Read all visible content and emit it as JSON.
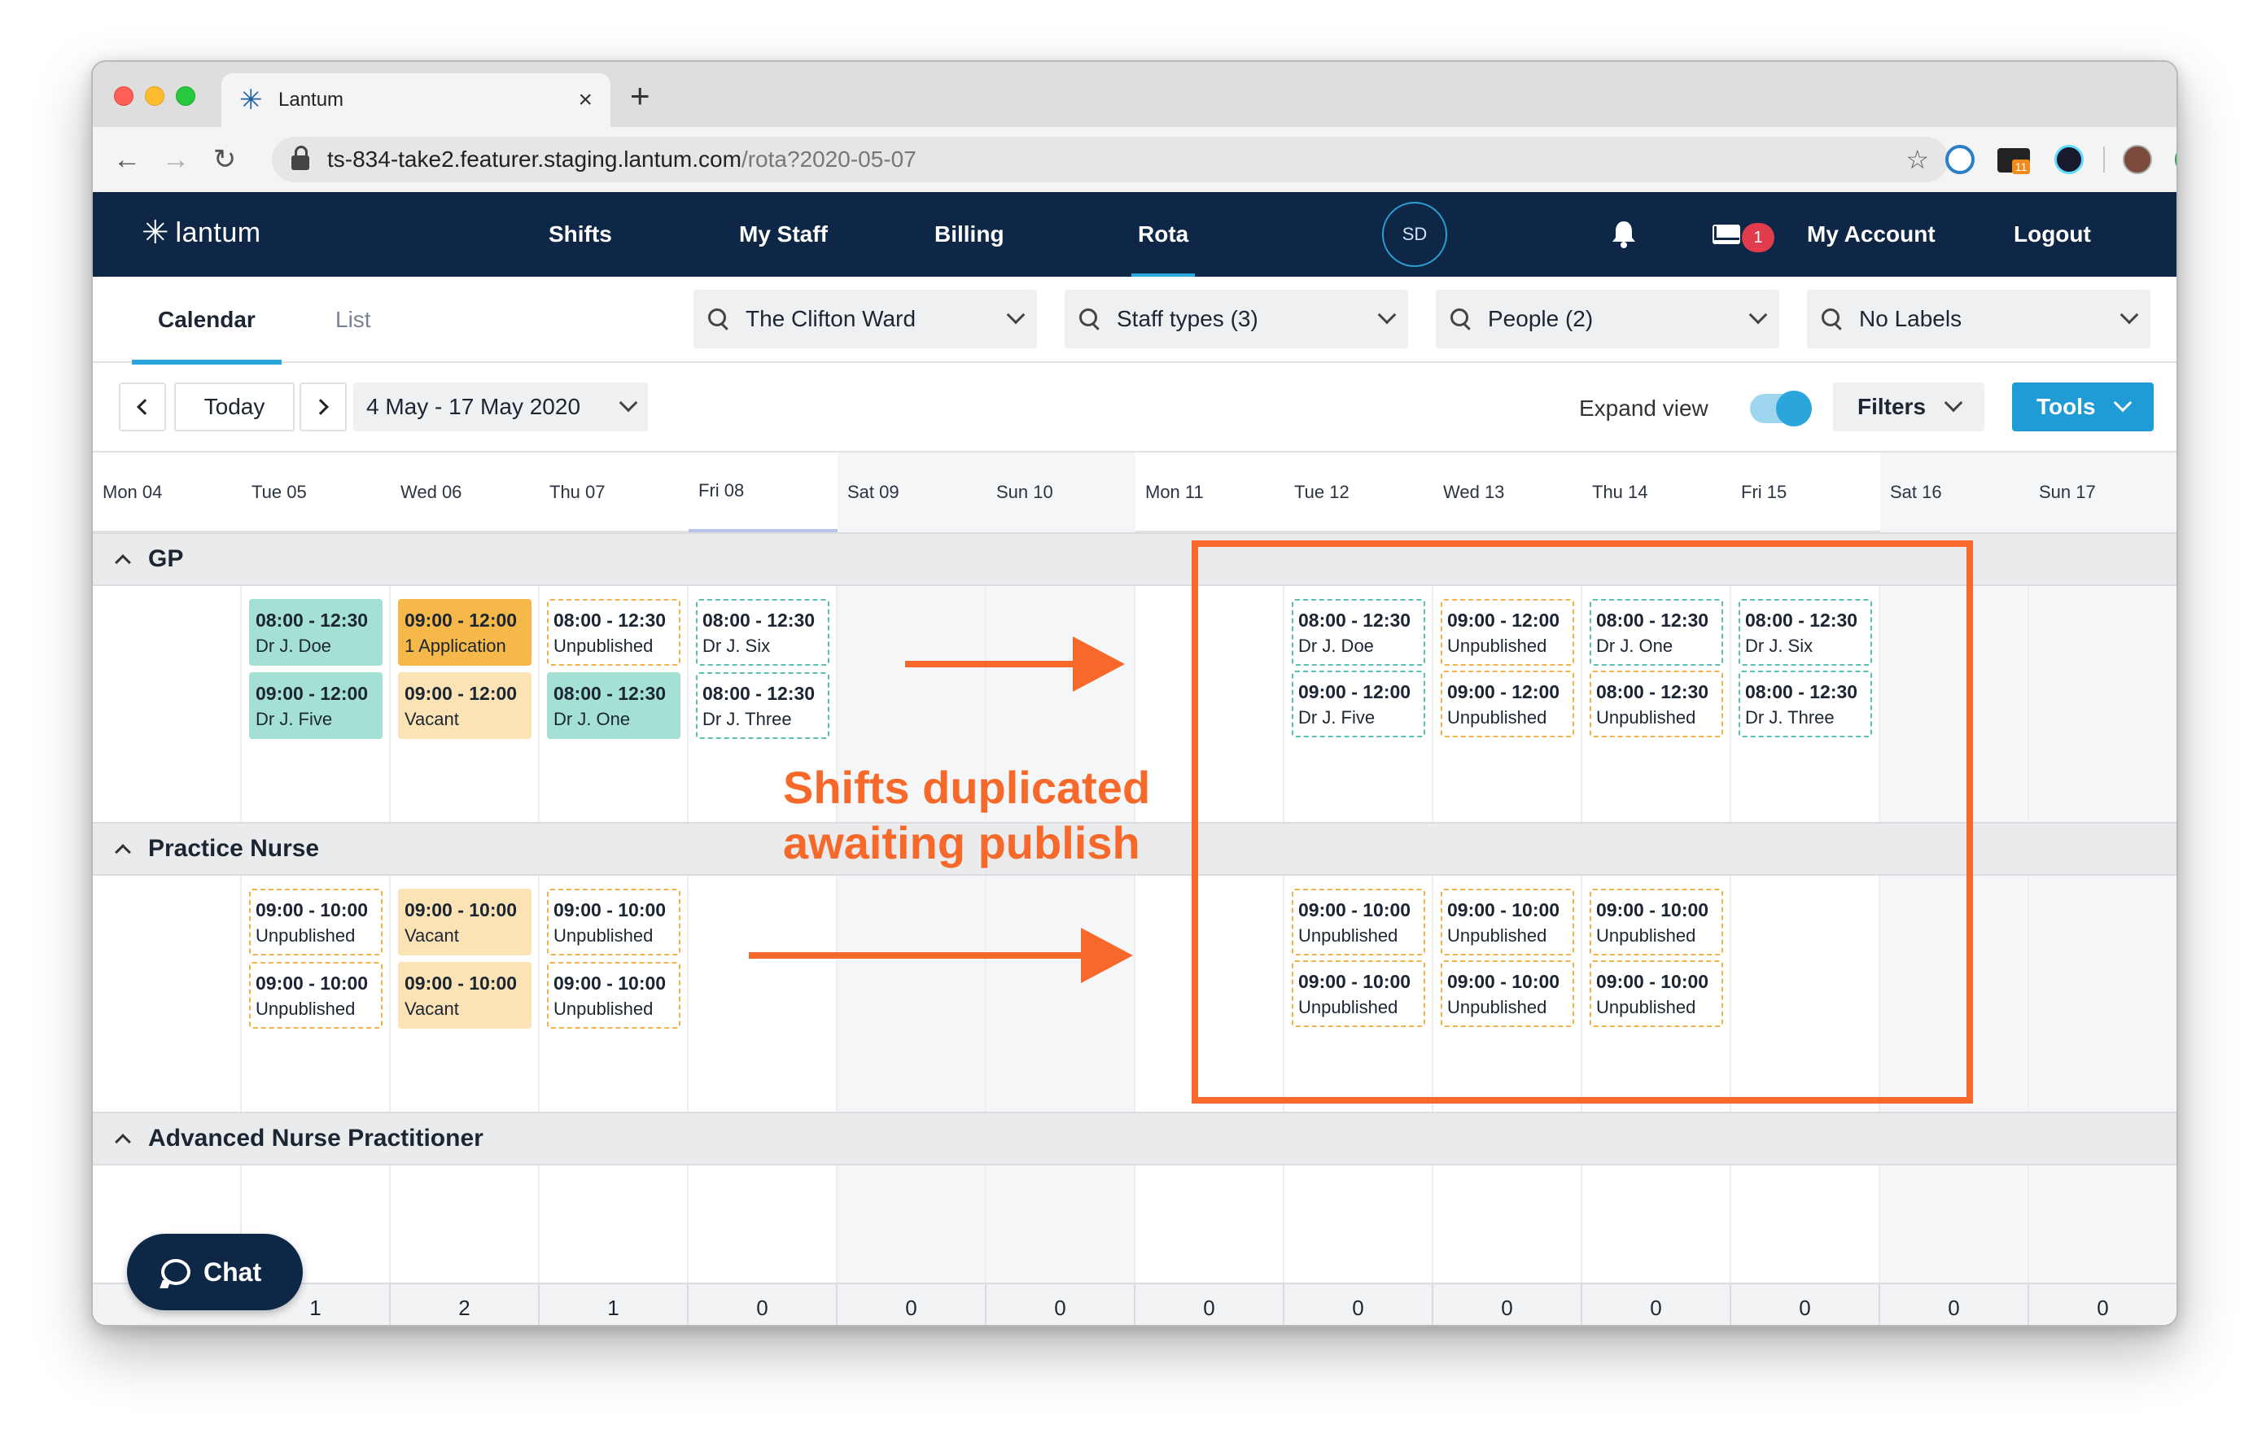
{
  "browser": {
    "tab_title": "Lantum",
    "url_host": "ts-834-take2.featurer.staging.lantum.com",
    "url_path": "/rota?2020-05-07",
    "extension_badge": "11"
  },
  "app": {
    "brand": "lantum",
    "nav": [
      "Shifts",
      "My Staff",
      "Billing",
      "Rota"
    ],
    "active_nav": "Rota",
    "avatar_initials": "SD",
    "mail_count": "1",
    "my_account": "My Account",
    "logout": "Logout"
  },
  "subheader": {
    "tabs": [
      "Calendar",
      "List"
    ],
    "filters": [
      "The Clifton Ward",
      "Staff types (3)",
      "People (2)",
      "No Labels"
    ]
  },
  "toolbar": {
    "today": "Today",
    "date_range": "4 May - 17 May 2020",
    "expand_view": "Expand view",
    "filters": "Filters",
    "tools": "Tools"
  },
  "days": [
    "Mon 04",
    "Tue 05",
    "Wed 06",
    "Thu 07",
    "Fri 08",
    "Sat 09",
    "Sun 10",
    "Mon 11",
    "Tue 12",
    "Wed 13",
    "Thu 14",
    "Fri 15",
    "Sat 16",
    "Sun 17"
  ],
  "groups": [
    "GP",
    "Practice Nurse",
    "Advanced Nurse Practitioner"
  ],
  "shifts": {
    "gp": [
      {
        "time": "08:00 - 12:30",
        "who": "Dr J. Doe"
      },
      {
        "time": "09:00 - 12:00",
        "who": "Dr J. Five"
      },
      {
        "time": "09:00 - 12:00",
        "who": "1 Application"
      },
      {
        "time": "09:00 - 12:00",
        "who": "Vacant"
      },
      {
        "time": "08:00 - 12:30",
        "who": "Unpublished"
      },
      {
        "time": "08:00 - 12:30",
        "who": "Dr J. One"
      },
      {
        "time": "08:00 - 12:30",
        "who": "Dr J. Six"
      },
      {
        "time": "08:00 - 12:30",
        "who": "Dr J. Three"
      },
      {
        "time": "08:00 - 12:30",
        "who": "Dr J. Doe"
      },
      {
        "time": "09:00 - 12:00",
        "who": "Dr J. Five"
      },
      {
        "time": "09:00 - 12:00",
        "who": "Unpublished"
      },
      {
        "time": "09:00 - 12:00",
        "who": "Unpublished"
      },
      {
        "time": "08:00 - 12:30",
        "who": "Dr J. One"
      },
      {
        "time": "08:00 - 12:30",
        "who": "Unpublished"
      },
      {
        "time": "08:00 - 12:30",
        "who": "Dr J. Six"
      },
      {
        "time": "08:00 - 12:30",
        "who": "Dr J. Three"
      }
    ],
    "nurse": [
      {
        "time": "09:00 - 10:00",
        "who": "Unpublished"
      },
      {
        "time": "09:00 - 10:00",
        "who": "Unpublished"
      },
      {
        "time": "09:00 - 10:00",
        "who": "Vacant"
      },
      {
        "time": "09:00 - 10:00",
        "who": "Vacant"
      },
      {
        "time": "09:00 - 10:00",
        "who": "Unpublished"
      },
      {
        "time": "09:00 - 10:00",
        "who": "Unpublished"
      },
      {
        "time": "09:00 - 10:00",
        "who": "Unpublished"
      },
      {
        "time": "09:00 - 10:00",
        "who": "Unpublished"
      },
      {
        "time": "09:00 - 10:00",
        "who": "Unpublished"
      },
      {
        "time": "09:00 - 10:00",
        "who": "Unpublished"
      },
      {
        "time": "09:00 - 10:00",
        "who": "Unpublished"
      },
      {
        "time": "09:00 - 10:00",
        "who": "Unpublished"
      }
    ]
  },
  "totals": [
    "1",
    "2",
    "1",
    "0",
    "0",
    "0",
    "0",
    "0",
    "0",
    "0",
    "0",
    "0",
    "0"
  ],
  "chat": "Chat",
  "annotation": {
    "line1": "Shifts duplicated",
    "line2": "awaiting publish",
    "color": "#f7692a"
  }
}
